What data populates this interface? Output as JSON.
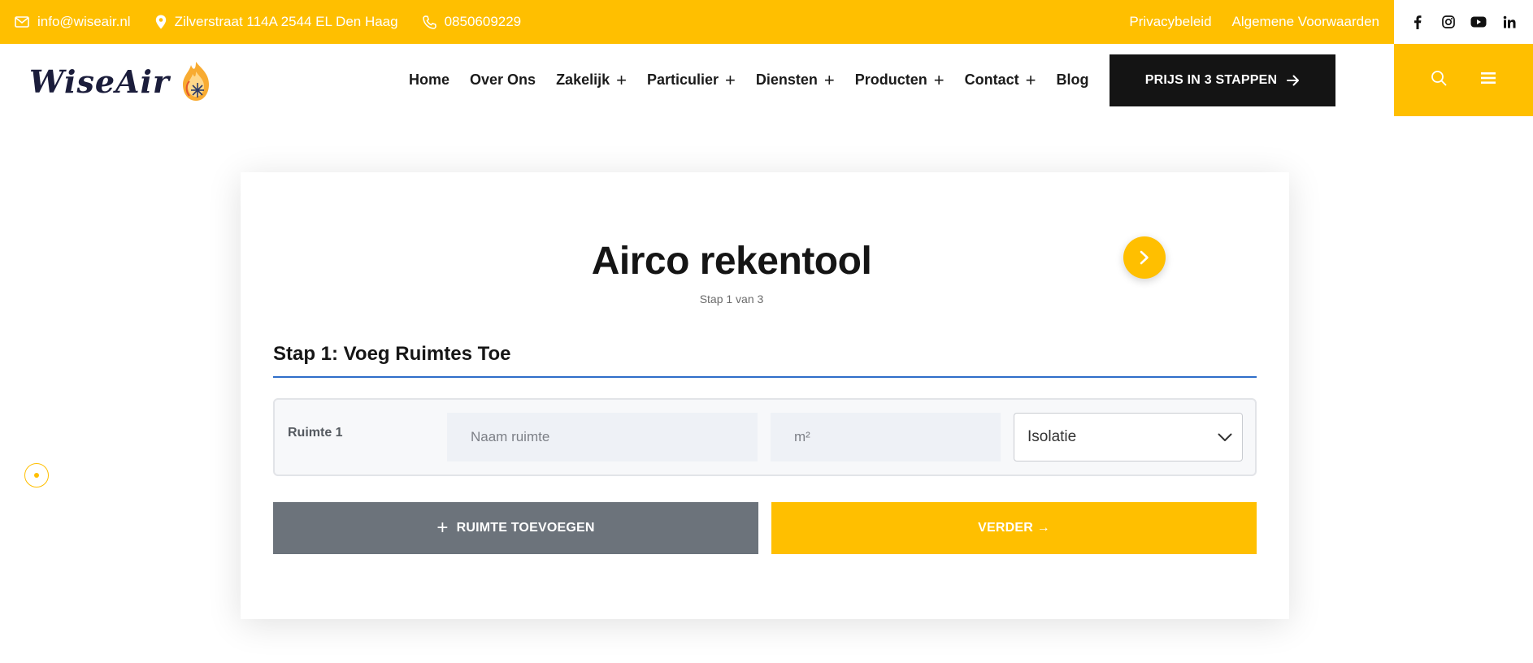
{
  "colors": {
    "accent": "#ffbf00",
    "dark": "#141414",
    "gray_button": "#6c737b",
    "divider": "#2f6ec9"
  },
  "topbar": {
    "email": "info@wiseair.nl",
    "address": "Zilverstraat 114A 2544 EL Den Haag",
    "phone": "0850609229",
    "links": [
      "Privacybeleid",
      "Algemene Voorwaarden"
    ],
    "social_icons": [
      "facebook-icon",
      "instagram-icon",
      "youtube-icon",
      "linkedin-icon"
    ]
  },
  "header": {
    "logo_text": "WiseAir",
    "nav": [
      {
        "label": "Home",
        "has_submenu": false
      },
      {
        "label": "Over Ons",
        "has_submenu": false
      },
      {
        "label": "Zakelijk",
        "has_submenu": true
      },
      {
        "label": "Particulier",
        "has_submenu": true
      },
      {
        "label": "Diensten",
        "has_submenu": true
      },
      {
        "label": "Producten",
        "has_submenu": true
      },
      {
        "label": "Contact",
        "has_submenu": true
      },
      {
        "label": "Blog",
        "has_submenu": false
      }
    ],
    "cta_label": "PRIJS IN 3 STAPPEN",
    "action_icons": [
      "search-icon",
      "menu-icon"
    ]
  },
  "tool": {
    "title": "Airco rekentool",
    "step_indicator": "Stap 1 van 3",
    "section_title": "Stap 1: Voeg Ruimtes Toe",
    "room": {
      "label": "Ruimte 1",
      "name_placeholder": "Naam ruimte",
      "area_placeholder": "m²",
      "insulation_selected": "Isolatie"
    },
    "add_room_label": "RUIMTE TOEVOEGEN",
    "next_label": "VERDER →"
  }
}
